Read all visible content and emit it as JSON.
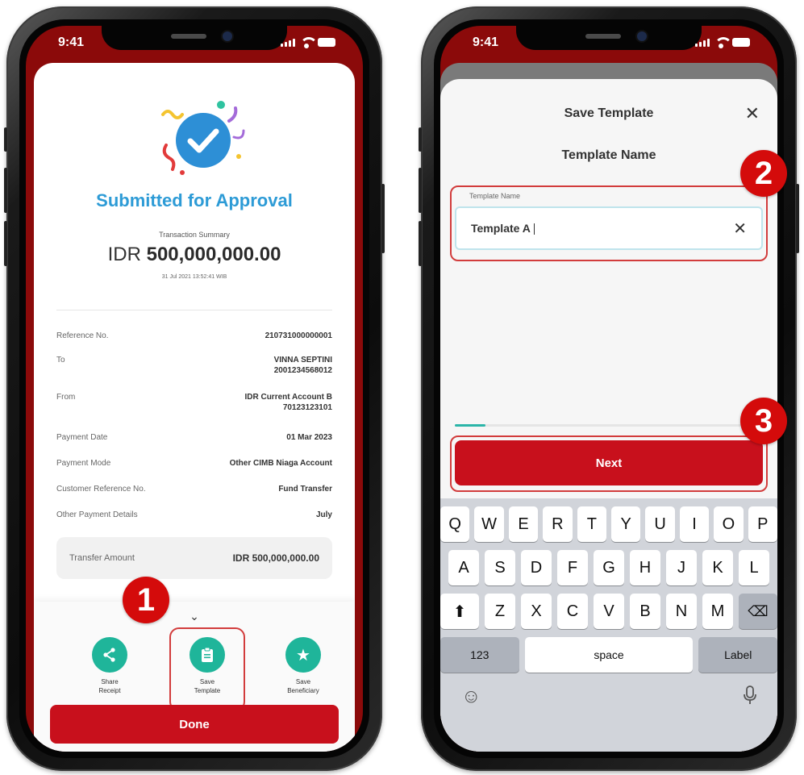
{
  "status_bar": {
    "time": "9:41"
  },
  "left": {
    "title": "Submitted for Approval",
    "summary_label": "Transaction Summary",
    "amount_currency": "IDR",
    "amount_value": "500,000,000.00",
    "timestamp": "31 Jul 2021 13:52:41 WIB",
    "details": [
      {
        "label": "Reference No.",
        "value": "210731000000001"
      },
      {
        "label": "To",
        "value": "VINNA SEPTINI",
        "value2": "2001234568012"
      },
      {
        "label": "From",
        "value": "IDR Current Account B",
        "value2": "70123123101"
      },
      {
        "label": "Payment Date",
        "value": "01 Mar 2023"
      },
      {
        "label": "Payment Mode",
        "value": "Other CIMB Niaga Account"
      },
      {
        "label": "Customer Reference No.",
        "value": "Fund Transfer"
      },
      {
        "label": "Other Payment Details",
        "value": "July"
      }
    ],
    "transfer": {
      "label": "Transfer Amount",
      "value": "IDR 500,000,000.00"
    },
    "actions": [
      {
        "label_line1": "Share",
        "label_line2": "Receipt",
        "icon": "share-icon"
      },
      {
        "label_line1": "Save",
        "label_line2": "Template",
        "icon": "clipboard-icon"
      },
      {
        "label_line1": "Save",
        "label_line2": "Beneficiary",
        "icon": "star-icon"
      }
    ],
    "done_label": "Done",
    "step_badge": "1"
  },
  "right": {
    "modal_title": "Save Template",
    "section_title": "Template Name",
    "field_label": "Template Name",
    "field_value": "Template A",
    "progress": 0.1,
    "next_label": "Next",
    "step_badges": [
      "2",
      "3"
    ],
    "keyboard": {
      "row1": [
        "Q",
        "W",
        "E",
        "R",
        "T",
        "Y",
        "U",
        "I",
        "O",
        "P"
      ],
      "row2": [
        "A",
        "S",
        "D",
        "F",
        "G",
        "H",
        "J",
        "K",
        "L"
      ],
      "row3": [
        "Z",
        "X",
        "C",
        "V",
        "B",
        "N",
        "M"
      ],
      "numbers_key": "123",
      "space_key": "space",
      "return_key": "Label"
    }
  },
  "colors": {
    "brand_red": "#c8101c",
    "title_blue": "#2d9bd6",
    "teal": "#1fb59a",
    "highlight_red": "#d23c3c"
  }
}
